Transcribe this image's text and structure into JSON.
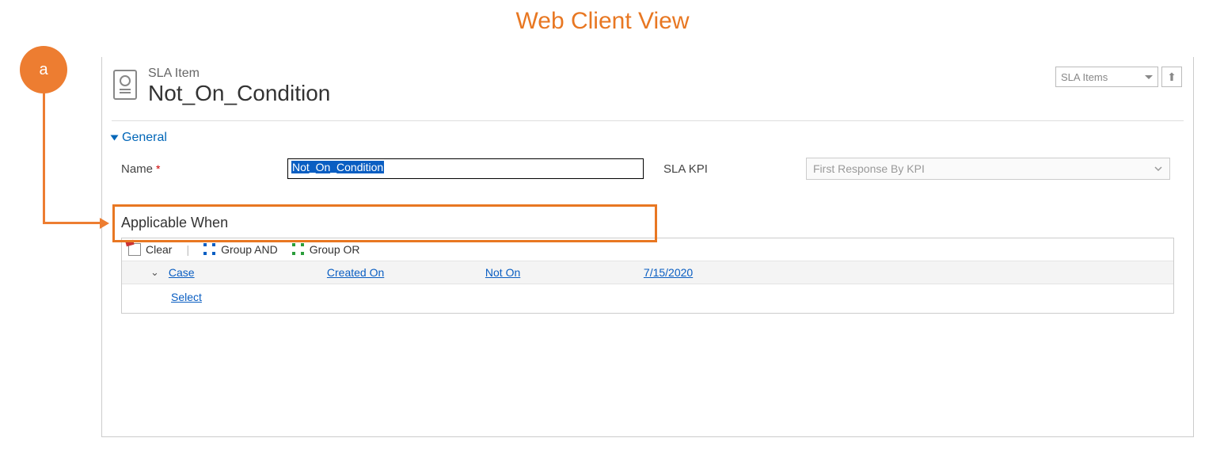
{
  "page_title": "Web Client View",
  "annotation_badge": "a",
  "header": {
    "entity_type": "SLA Item",
    "record_name": "Not_On_Condition",
    "view_selector": "SLA Items"
  },
  "section": {
    "title": "General",
    "name_label": "Name",
    "name_value": "Not_On_Condition",
    "kpi_label": "SLA KPI",
    "kpi_value": "First Response By KPI"
  },
  "applicable": {
    "title": "Applicable When",
    "toolbar": {
      "clear": "Clear",
      "group_and": "Group AND",
      "group_or": "Group OR"
    },
    "row": {
      "entity": "Case",
      "field": "Created On",
      "operator": "Not On",
      "value": "7/15/2020"
    },
    "select": "Select"
  }
}
